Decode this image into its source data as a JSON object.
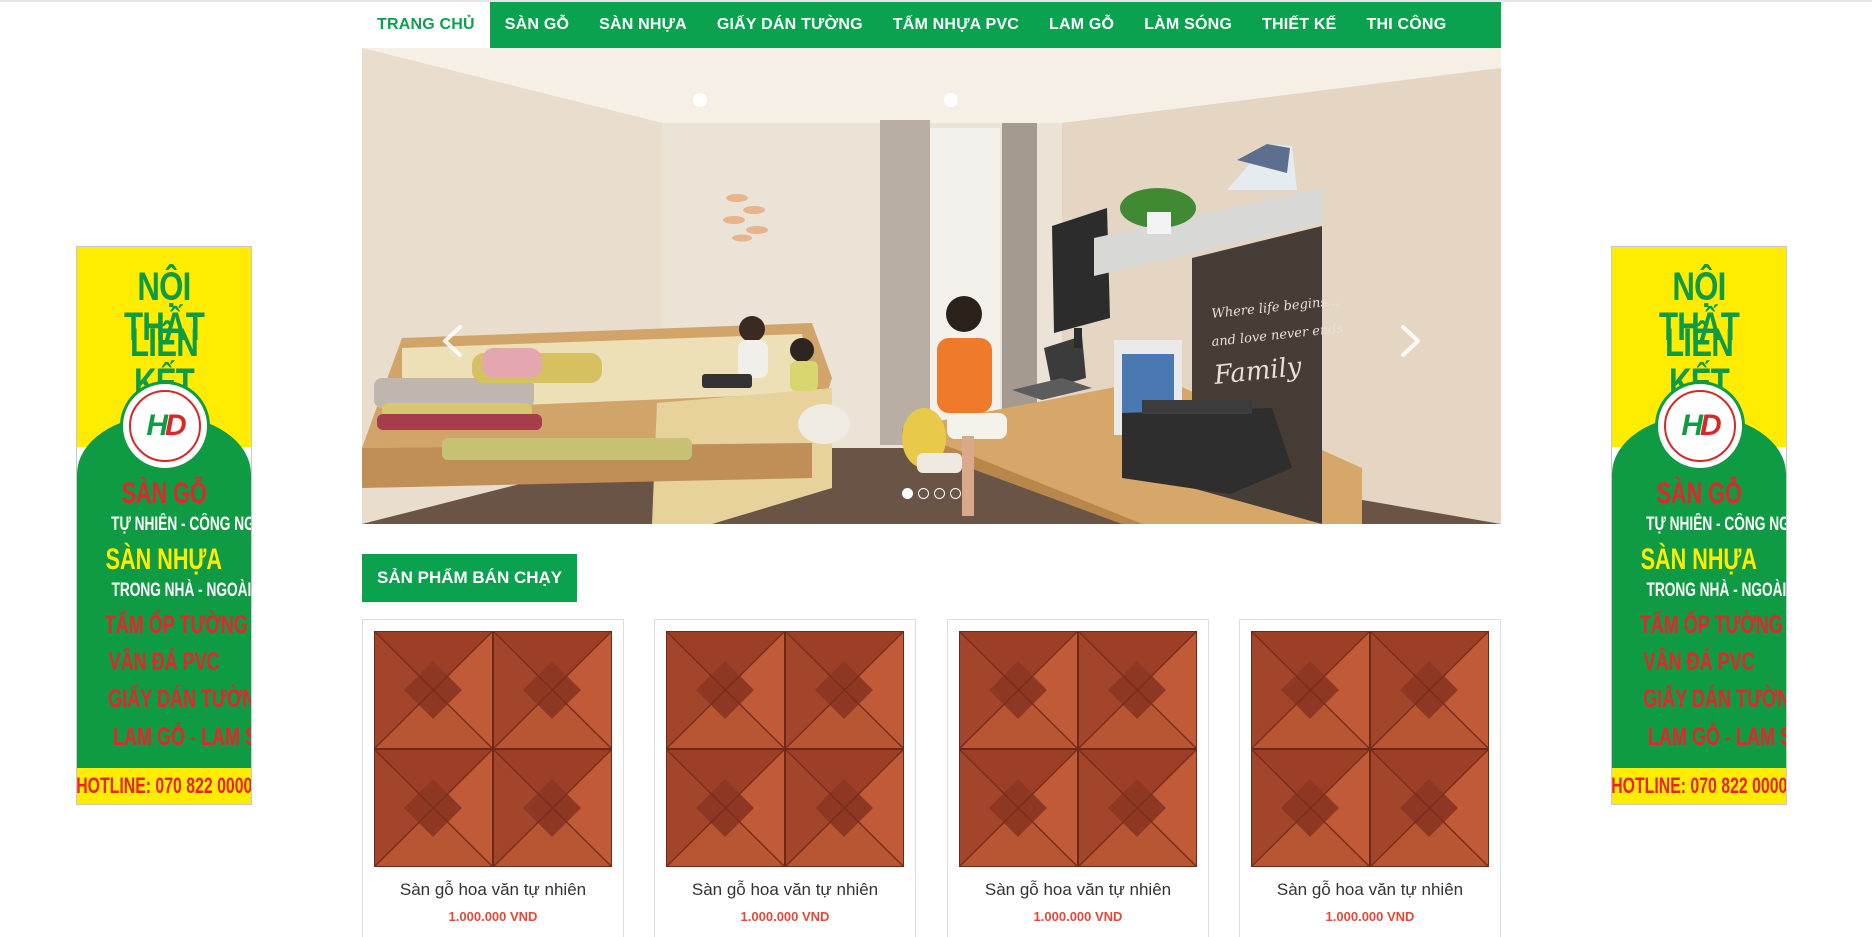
{
  "nav": {
    "items": [
      {
        "label": "TRANG CHỦ",
        "active": true
      },
      {
        "label": "SÀN GỖ",
        "active": false
      },
      {
        "label": "SÀN NHỰA",
        "active": false
      },
      {
        "label": "GIẤY DÁN TƯỜNG",
        "active": false
      },
      {
        "label": "TẤM NHỰA PVC",
        "active": false
      },
      {
        "label": "LAM GỖ",
        "active": false
      },
      {
        "label": "LÀM SÓNG",
        "active": false
      },
      {
        "label": "THIẾT KẾ",
        "active": false
      },
      {
        "label": "THI CÔNG",
        "active": false
      }
    ]
  },
  "slider": {
    "prev_icon": "chevron-left-icon",
    "next_icon": "chevron-right-icon",
    "slide_count": 4,
    "active_slide": 1,
    "wall_text": [
      "Where life begins...",
      "and love never ends",
      "Family"
    ]
  },
  "section": {
    "title": "SẢN PHẨM BÁN CHẠY"
  },
  "products": [
    {
      "name": "Sàn gỗ hoa văn tự nhiên",
      "price": "1.000.000 VND"
    },
    {
      "name": "Sàn gỗ hoa văn tự nhiên",
      "price": "1.000.000 VND"
    },
    {
      "name": "Sàn gỗ hoa văn tự nhiên",
      "price": "1.000.000 VND"
    },
    {
      "name": "Sàn gỗ hoa văn tự nhiên",
      "price": "1.000.000 VND"
    }
  ],
  "banner": {
    "title_line1": "NỘI THẤT",
    "title_line2": "LIÊN KẾT",
    "logo_text_h": "H",
    "logo_text_d": "D",
    "lines": [
      "SÀN GỖ",
      "TỰ NHIÊN - CÔNG NGHIỆP",
      "SÀN NHỰA",
      "TRONG NHÀ - NGOÀI TRỜI",
      "TẤM ỐP TƯỜNG",
      "VÂN ĐÁ PVC",
      "GIẤY DÁN TƯỜNG",
      "LAM GỖ - LAM SÓNG"
    ],
    "hotline": "HOTLINE: 070 822 0000"
  },
  "colors": {
    "brand_green": "#0aa24e",
    "banner_yellow": "#ffec00",
    "price_red": "#e24a3a"
  }
}
